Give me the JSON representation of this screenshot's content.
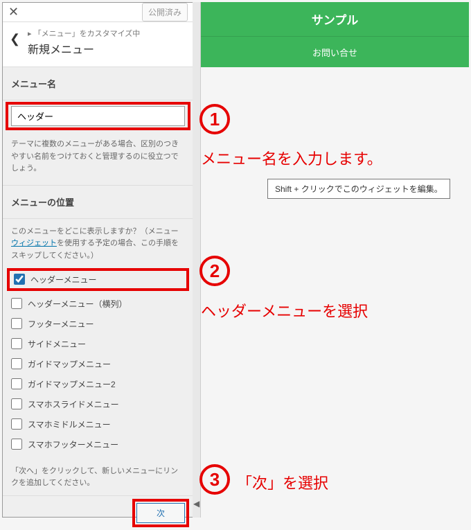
{
  "topbar": {
    "publish_label": "公開済み"
  },
  "crumb": {
    "small": "「メニュー」をカスタマイズ中",
    "title": "新規メニュー"
  },
  "menu_name": {
    "header": "メニュー名",
    "value": "ヘッダー",
    "helper": "テーマに複数のメニューがある場合、区別のつきやすい名前をつけておくと管理するのに役立つでしょう。"
  },
  "menu_loc": {
    "header": "メニューの位置",
    "desc_pre": "このメニューをどこに表示しますか？（メニュー",
    "desc_link": "ウィジェット",
    "desc_post": "を使用する予定の場合、この手順をスキップしてください。）",
    "options": [
      {
        "label": "ヘッダーメニュー",
        "checked": true
      },
      {
        "label": "ヘッダーメニュー（横列）",
        "checked": false
      },
      {
        "label": "フッターメニュー",
        "checked": false
      },
      {
        "label": "サイドメニュー",
        "checked": false
      },
      {
        "label": "ガイドマップメニュー",
        "checked": false
      },
      {
        "label": "ガイドマップメニュー2",
        "checked": false
      },
      {
        "label": "スマホスライドメニュー",
        "checked": false
      },
      {
        "label": "スマホミドルメニュー",
        "checked": false
      },
      {
        "label": "スマホフッターメニュー",
        "checked": false
      }
    ]
  },
  "next": {
    "desc": "「次へ」をクリックして、新しいメニューにリンクを追加してください。",
    "button": "次"
  },
  "preview": {
    "title": "サンプル",
    "contact": "お問い合せ"
  },
  "tooltip": "Shift + クリックでこのウィジェットを編集。",
  "annotations": {
    "n1": "1",
    "t1": "メニュー名を入力します。",
    "n2": "2",
    "t2": "ヘッダーメニューを選択",
    "n3": "3",
    "t3": "「次」を選択"
  }
}
